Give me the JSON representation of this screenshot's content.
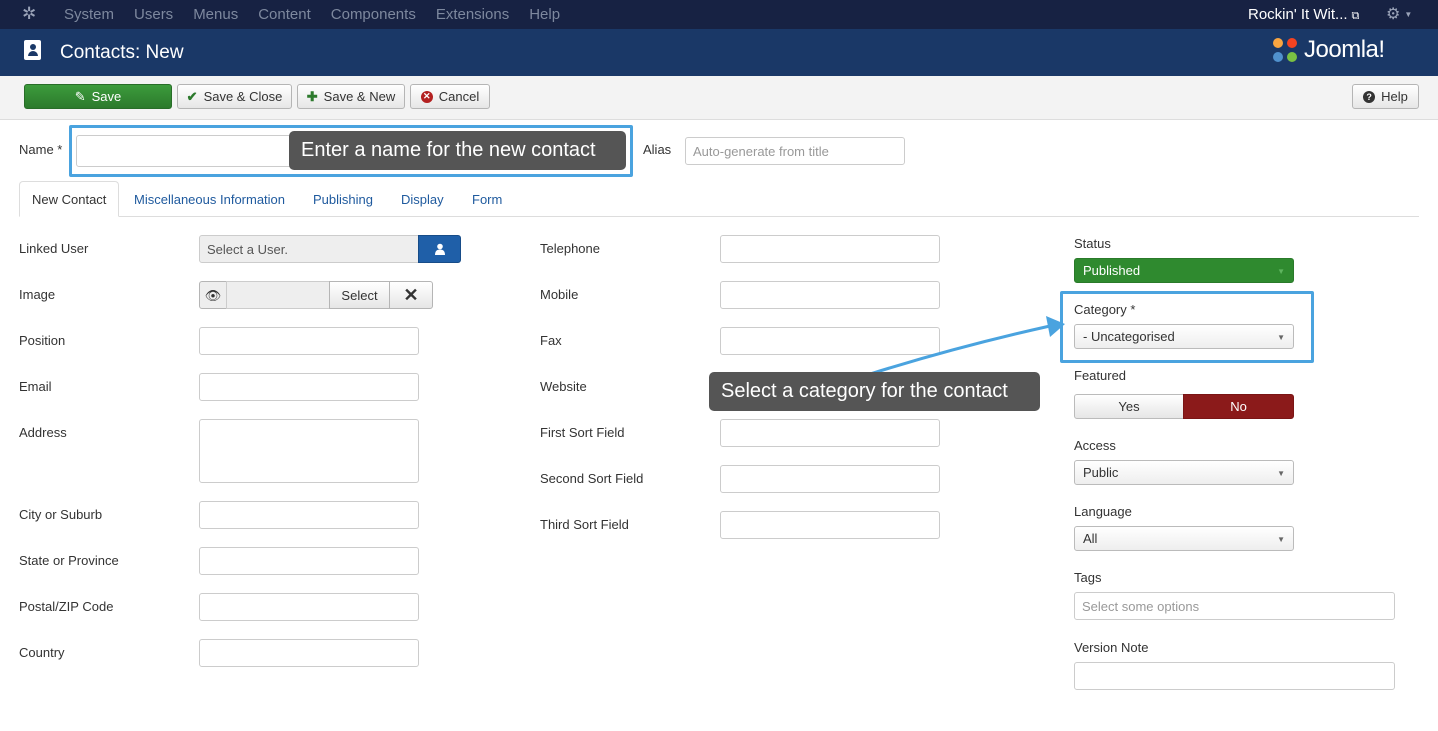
{
  "topnav": {
    "menu": [
      "System",
      "Users",
      "Menus",
      "Content",
      "Components",
      "Extensions",
      "Help"
    ],
    "site_name": "Rockin' It Wit..."
  },
  "header": {
    "title": "Contacts: New",
    "logo_text": "Joomla!"
  },
  "toolbar": {
    "save": "Save",
    "save_close": "Save & Close",
    "save_new": "Save & New",
    "cancel": "Cancel",
    "help": "Help"
  },
  "name_field": {
    "label": "Name *",
    "value": ""
  },
  "alias_field": {
    "label": "Alias",
    "placeholder": "Auto-generate from title"
  },
  "tabs": [
    "New Contact",
    "Miscellaneous Information",
    "Publishing",
    "Display",
    "Form"
  ],
  "left_fields": {
    "linked_user": {
      "label": "Linked User",
      "value": "Select a User."
    },
    "image": {
      "label": "Image",
      "select": "Select"
    },
    "position": {
      "label": "Position"
    },
    "email": {
      "label": "Email"
    },
    "address": {
      "label": "Address"
    },
    "city": {
      "label": "City or Suburb"
    },
    "state": {
      "label": "State or Province"
    },
    "postal": {
      "label": "Postal/ZIP Code"
    },
    "country": {
      "label": "Country"
    }
  },
  "mid_fields": {
    "telephone": "Telephone",
    "mobile": "Mobile",
    "fax": "Fax",
    "website": "Website",
    "first_sort": "First Sort Field",
    "second_sort": "Second Sort Field",
    "third_sort": "Third Sort Field"
  },
  "right_panel": {
    "status": {
      "label": "Status",
      "value": "Published"
    },
    "category": {
      "label": "Category *",
      "value": "- Uncategorised"
    },
    "featured": {
      "label": "Featured",
      "yes": "Yes",
      "no": "No"
    },
    "access": {
      "label": "Access",
      "value": "Public"
    },
    "language": {
      "label": "Language",
      "value": "All"
    },
    "tags": {
      "label": "Tags",
      "placeholder": "Select some options"
    },
    "version_note": {
      "label": "Version Note"
    }
  },
  "tooltips": {
    "name": "Enter a name for the new contact",
    "category": "Select a category for the contact"
  },
  "colors": {
    "topnav_bg": "#172243",
    "header_bg": "#1a3867",
    "save_green": "#2f8a2f",
    "no_red": "#8b1a1a",
    "highlight_blue": "#4aa3df"
  }
}
